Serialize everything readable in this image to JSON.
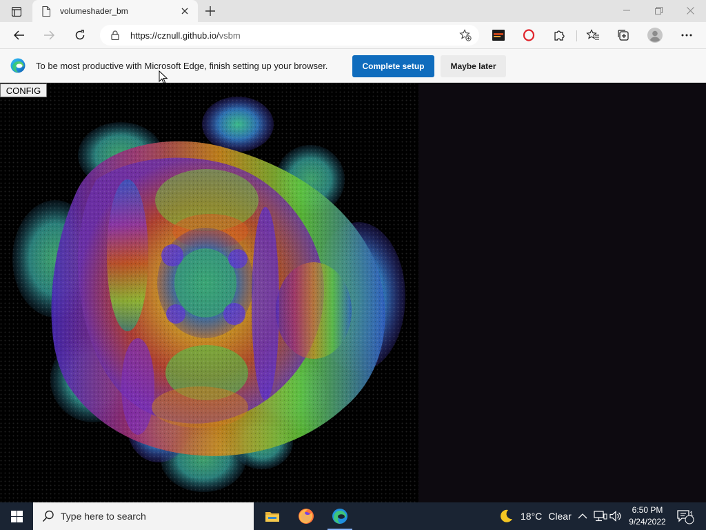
{
  "browser": {
    "tab": {
      "title": "volumeshader_bm"
    },
    "address": {
      "url_host": "https://cznull.github.io/",
      "url_path": "vsbm"
    }
  },
  "infobar": {
    "message": "To be most productive with Microsoft Edge, finish setting up your browser.",
    "primary_label": "Complete setup",
    "secondary_label": "Maybe later"
  },
  "page": {
    "config_label": "CONFIG"
  },
  "taskbar": {
    "search_placeholder": "Type here to search",
    "weather_temp": "18°C",
    "weather_cond": "Clear",
    "time": "6:50 PM",
    "date": "9/24/2022",
    "notification_count": "1"
  },
  "colors": {
    "accent": "#0f6cbd",
    "taskbar": "#1a2433",
    "side_panel": "#0d0a10"
  }
}
